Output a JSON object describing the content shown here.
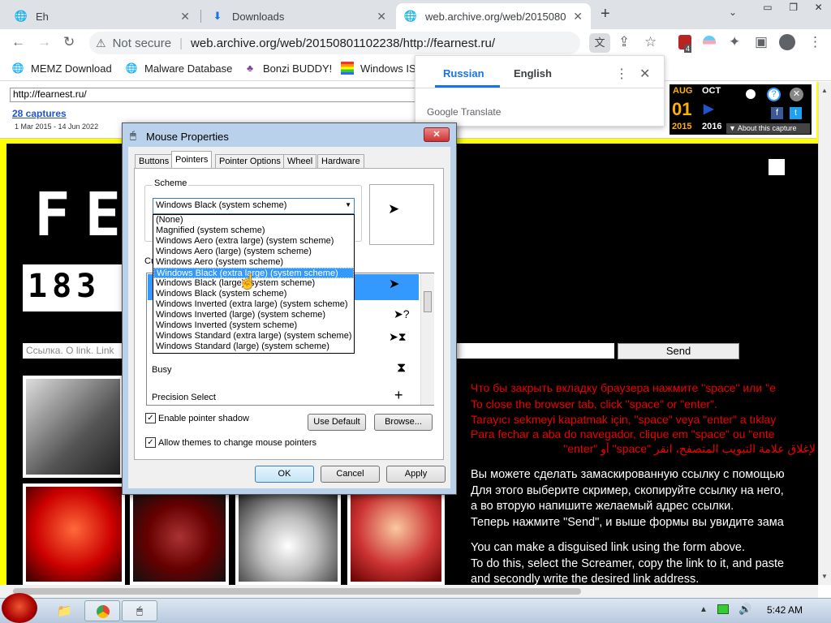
{
  "browser": {
    "tabs": [
      {
        "title": "Eh",
        "icon": "globe-icon"
      },
      {
        "title": "Downloads",
        "icon": "download-icon"
      },
      {
        "title": "web.archive.org/web/2015080",
        "icon": "globe-icon"
      }
    ],
    "new_tab": "+",
    "security": "Not secure",
    "url": "web.archive.org/web/20150801102238/http://fearnest.ru/",
    "extension_badge": "4",
    "bookmarks": [
      {
        "label": "MEMZ Download",
        "icon": "globe-icon"
      },
      {
        "label": "Malware Database",
        "icon": "globe-icon"
      },
      {
        "label": "Bonzi BUDDY!",
        "icon": "bonzi-icon"
      },
      {
        "label": "Windows IS",
        "icon": "windows-flag-icon"
      }
    ]
  },
  "translate": {
    "lang_from": "Russian",
    "lang_to": "English",
    "brand_google": "Google",
    "brand_translate": "Translate"
  },
  "wayback": {
    "url_value": "http://fearnest.ru/",
    "captures": "28 captures",
    "range": "1 Mar 2015 - 14 Jun 2022",
    "months": [
      "AUG",
      "OCT"
    ],
    "day": "01",
    "years": [
      "2015",
      "2016"
    ],
    "about": "▼ About this capture"
  },
  "site": {
    "title": "FE      T",
    "number": "183",
    "link_placeholder": "Ссылка. O link. Link",
    "send": "Send",
    "red_lines": [
      "Что бы закрыть вкладку браузера нажмите \"space\" или \"e",
      "To close the browser tab, click \"space\" or \"enter\".",
      "Tarayıcı sekmeyi kapatmak için, \"space\" veya \"enter\" a tıklay",
      "Para fechar a aba do navegador, clique em \"space\" ou \"ente",
      "لإغلاق علامة التبويب المتصفح، انقر \"space\" أو \"enter\""
    ],
    "white_lines": [
      "Вы можете сделать замаскированную ссылку с помощью",
      "Для этого выберите скример, скопируйте ссылку на него,",
      "а во вторую напишите желаемый адрес ссылки.",
      "Теперь нажмите \"Send\", и выше формы вы увидите зама",
      "You can make a disguised link using the form above.",
      "To do this, select the Screamer, copy the link to it, and paste",
      "and secondly write the desired link address."
    ]
  },
  "dialog": {
    "title": "Mouse Properties",
    "tabs": [
      "Buttons",
      "Pointers",
      "Pointer Options",
      "Wheel",
      "Hardware"
    ],
    "scheme_label": "Scheme",
    "scheme_value": "Windows Black (system scheme)",
    "scheme_options": [
      "(None)",
      "Magnified (system scheme)",
      "Windows Aero (extra large) (system scheme)",
      "Windows Aero (large) (system scheme)",
      "Windows Aero (system scheme)",
      "Windows Black (extra large) (system scheme)",
      "Windows Black (large) (system scheme)",
      "Windows Black (system scheme)",
      "Windows Inverted (extra large) (system scheme)",
      "Windows Inverted (large) (system scheme)",
      "Windows Inverted (system scheme)",
      "Windows Standard (extra large) (system scheme)",
      "Windows Standard (large) (system scheme)"
    ],
    "highlighted_index": 5,
    "customize_label": "Cu",
    "cursor_rows": [
      "Busy",
      "Precision Select"
    ],
    "shadow_label": "Enable pointer shadow",
    "themes_label": "Allow themes to change mouse pointers",
    "use_default": "Use Default",
    "browse": "Browse...",
    "ok": "OK",
    "cancel": "Cancel",
    "apply": "Apply"
  },
  "taskbar": {
    "time": "5:42 AM"
  }
}
